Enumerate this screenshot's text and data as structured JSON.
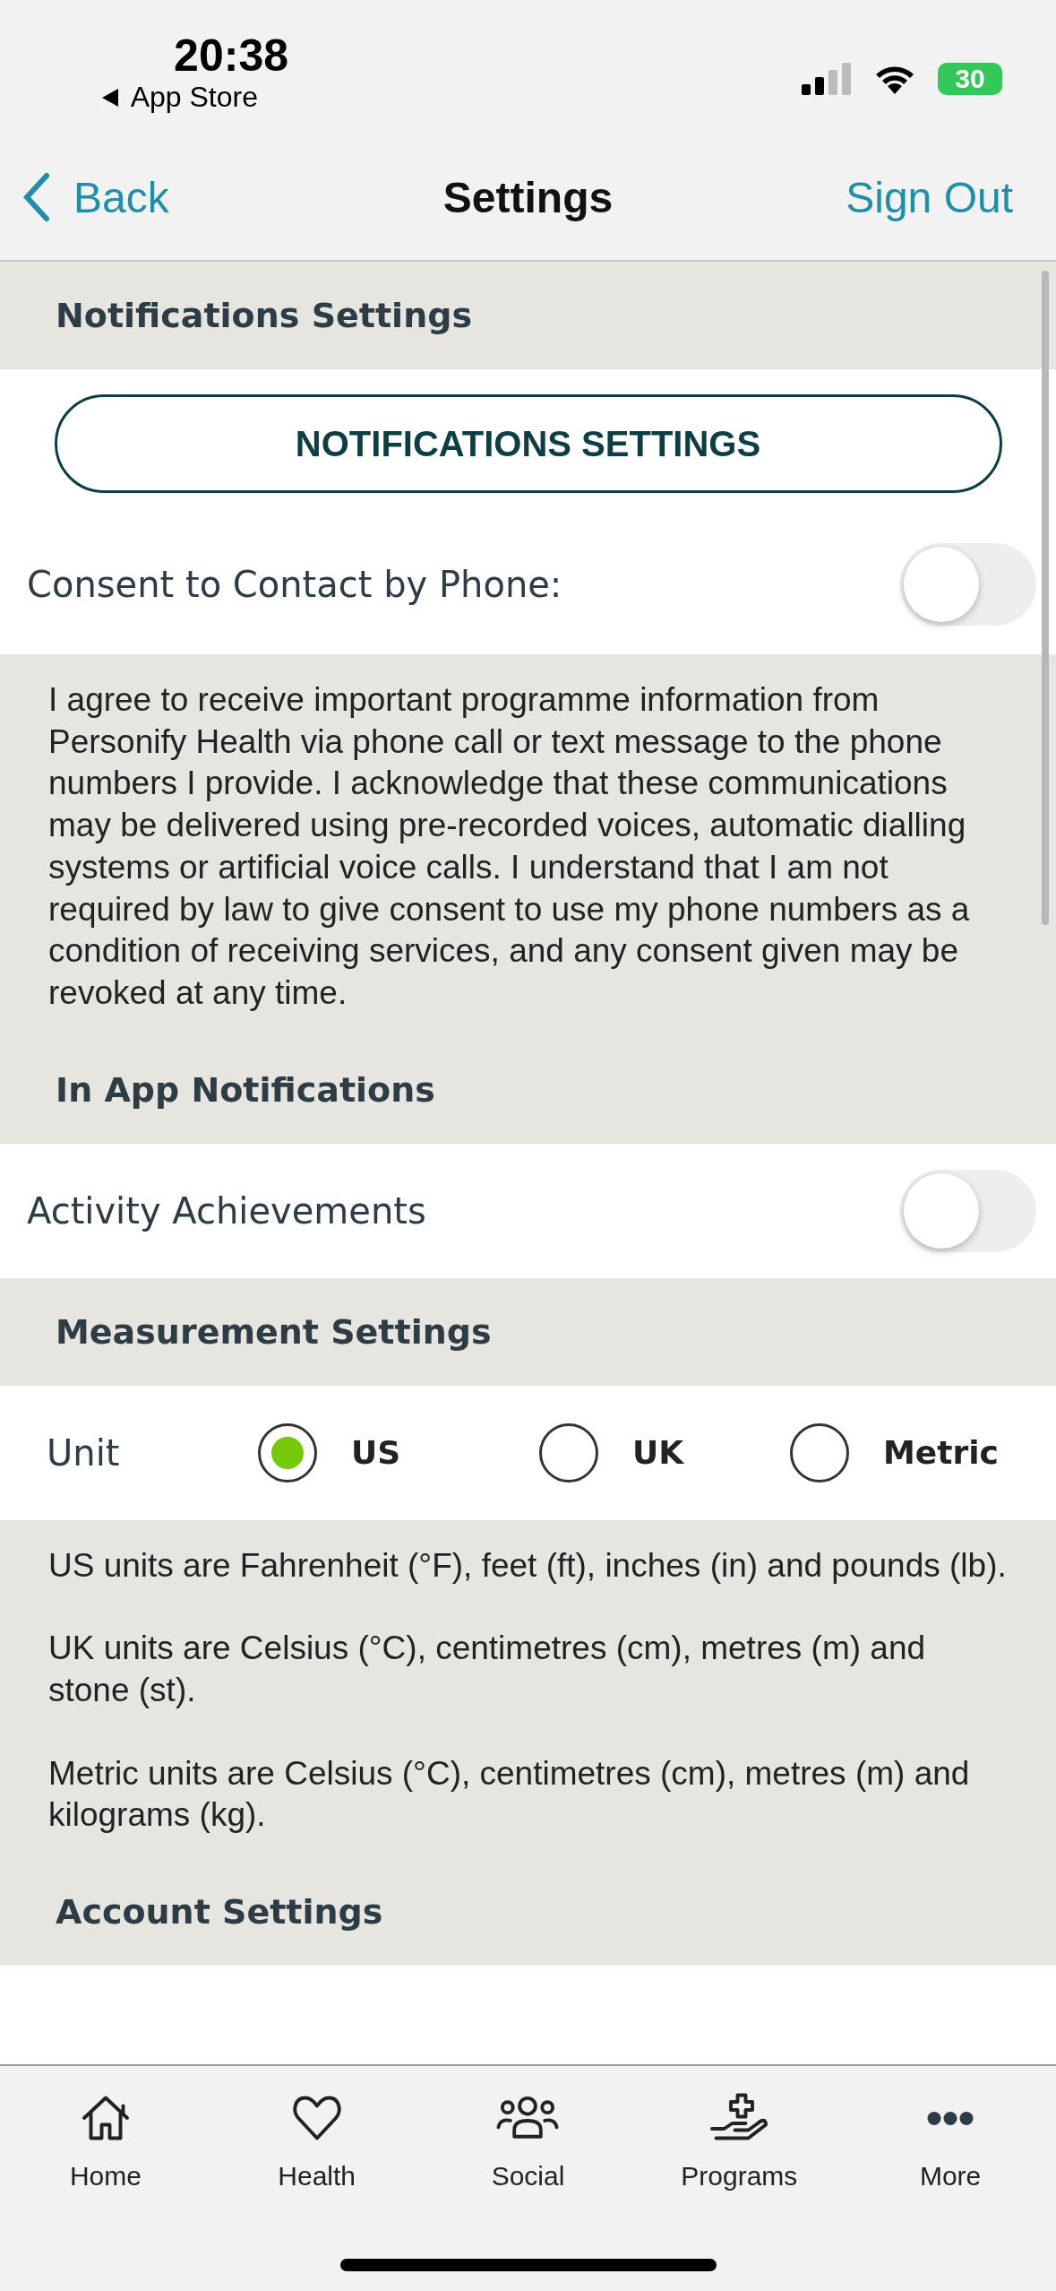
{
  "status_bar": {
    "time": "20:38",
    "back_app": "App Store",
    "battery": "30"
  },
  "nav": {
    "back": "Back",
    "title": "Settings",
    "action": "Sign Out"
  },
  "sections": [
    {
      "kind": "header",
      "title": "Notifications Settings"
    },
    {
      "kind": "button",
      "label": "NOTIFICATIONS SETTINGS"
    },
    {
      "kind": "toggle",
      "label": "Consent to Contact by Phone:",
      "on": false
    },
    {
      "kind": "note",
      "paragraphs": [
        "I agree to receive important programme information from Personify Health via phone call or text message to the phone numbers I provide. I acknowledge that these communications may be delivered using pre-recorded voices, automatic dialling systems or artificial voice calls. I understand that I am not required by law to give consent to use my phone numbers as a condition of receiving services, and any consent given may be revoked at any time."
      ]
    },
    {
      "kind": "header",
      "title": "In App Notifications"
    },
    {
      "kind": "toggle",
      "label": "Activity Achievements",
      "on": false
    },
    {
      "kind": "header",
      "title": "Measurement Settings"
    },
    {
      "kind": "radio",
      "label": "Unit",
      "options": [
        {
          "label": "US",
          "selected": true
        },
        {
          "label": "UK",
          "selected": false
        },
        {
          "label": "Metric",
          "selected": false
        }
      ]
    },
    {
      "kind": "note",
      "paragraphs": [
        "US units are Fahrenheit (°F), feet (ft), inches (in) and pounds (lb).",
        "UK units are Celsius (°C), centimetres (cm), metres (m) and stone (st).",
        "Metric units are Celsius (°C), centimetres (cm), metres (m) and kilograms (kg)."
      ]
    },
    {
      "kind": "header",
      "title": "Account Settings"
    }
  ],
  "tab_bar": [
    {
      "kind": "home",
      "label": "Home"
    },
    {
      "kind": "health",
      "label": "Health"
    },
    {
      "kind": "social",
      "label": "Social"
    },
    {
      "kind": "programs",
      "label": "Programs"
    },
    {
      "kind": "more",
      "label": "More"
    }
  ]
}
